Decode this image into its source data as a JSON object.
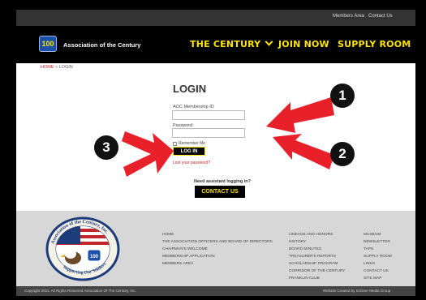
{
  "topbar": {
    "members_area": "Members Area",
    "contact_us": "Contact Us"
  },
  "header": {
    "logo_text": "100",
    "site_name": "Association of the Century",
    "nav": {
      "century": "THE CENTURY",
      "join": "JOIN NOW",
      "supply": "SUPPLY ROOM"
    }
  },
  "breadcrumb": {
    "home": "HOME",
    "separator": " » ",
    "current": "LOGIN"
  },
  "login": {
    "title": "LOGIN",
    "membership_label": "AOC Membership ID",
    "membership_value": "",
    "password_label": "Password",
    "password_value": "",
    "remember_label": "Remember Me",
    "button": "LOG IN",
    "lost_password": "Lost your password?"
  },
  "assist": {
    "text": "Need assistant logging in?",
    "button": "CONTACT US"
  },
  "markers": {
    "m1": "1",
    "m2": "2",
    "m3": "3"
  },
  "footer": {
    "seal_text_top": "Association of the Century, Inc.",
    "seal_text_bottom": "Supporting Our Soldiers",
    "seal_badge": "100",
    "col1": [
      "HOME",
      "THE ASSOCIATION OFFICERS AND BOARD OF DIRECTORS",
      "CHAIRMAN'S WELCOME",
      "MEMBERSHIP APPLICATION",
      "MEMBERS AREA"
    ],
    "col2": [
      "LINEAGE AND HONORS",
      "HISTORY",
      "BOARD MINUTES",
      "TREASURER'S REPORTS",
      "SCHOLARSHIP PROGRAM",
      "CORRIDOR OF THE CENTURY",
      "FRANKLIN CLUB"
    ],
    "col3": [
      "MUSEUM",
      "NEWSLETTER",
      "TAPS",
      "SUPPLY ROOM",
      "LINKS",
      "CONTACT US",
      "SITE MAP"
    ]
  },
  "bottombar": {
    "copyright": "Copyright 2021. All Rights Reserved Association Of The Century, Inc.",
    "credit": "Website Created by Schiner Media Group"
  },
  "colors": {
    "accent": "#ffe400",
    "header_bg": "#000000",
    "link_red": "#c0262c",
    "arrow_red": "#e8202a",
    "footer_bg": "#d7d7d7"
  }
}
